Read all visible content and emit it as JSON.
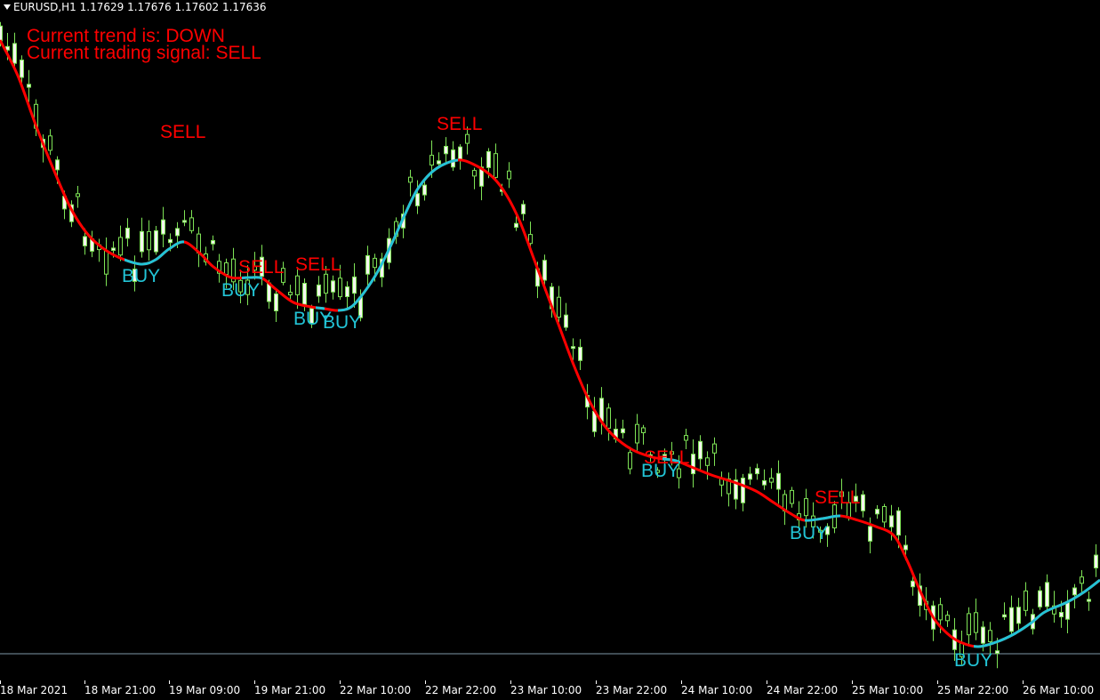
{
  "window": {
    "symbol_line": "EURUSD,H1  1.17629 1.17676 1.17602 1.17636"
  },
  "indicator": {
    "trend_text": "Current trend is: DOWN",
    "signal_text": "Current trading signal: SELL"
  },
  "colors": {
    "background": "#000000",
    "candle": "#7ee356",
    "buy": "#22c4d6",
    "sell": "#ff0000",
    "text": "#ffffff"
  },
  "signals": [
    {
      "label": "SELL",
      "type": "sell",
      "bar": 23
    },
    {
      "label": "BUY",
      "type": "buy",
      "bar": 20
    },
    {
      "label": "SELL",
      "type": "sell",
      "bar": 36
    },
    {
      "label": "BUY",
      "type": "buy",
      "bar": 34
    },
    {
      "label": "SELL",
      "type": "sell",
      "bar": 45
    },
    {
      "label": "BUY",
      "type": "buy",
      "bar": 44
    },
    {
      "label": "BUY",
      "type": "buy",
      "bar": 49
    },
    {
      "label": "SELL",
      "type": "sell",
      "bar": 65
    },
    {
      "label": "BUY",
      "type": "buy",
      "bar": 93
    },
    {
      "label": "SELL",
      "type": "sell",
      "bar": 94
    },
    {
      "label": "BUY",
      "type": "buy",
      "bar": 113
    },
    {
      "label": "SELL",
      "type": "sell",
      "bar": 118
    },
    {
      "label": "BUY",
      "type": "buy",
      "bar": 137
    }
  ],
  "time_axis": [
    "18 Mar 2021",
    "18 Mar 21:00",
    "19 Mar 09:00",
    "19 Mar 21:00",
    "22 Mar 10:00",
    "22 Mar 22:00",
    "23 Mar 10:00",
    "23 Mar 22:00",
    "24 Mar 10:00",
    "24 Mar 22:00",
    "25 Mar 10:00",
    "25 Mar 22:00",
    "26 Mar 10:00"
  ]
}
